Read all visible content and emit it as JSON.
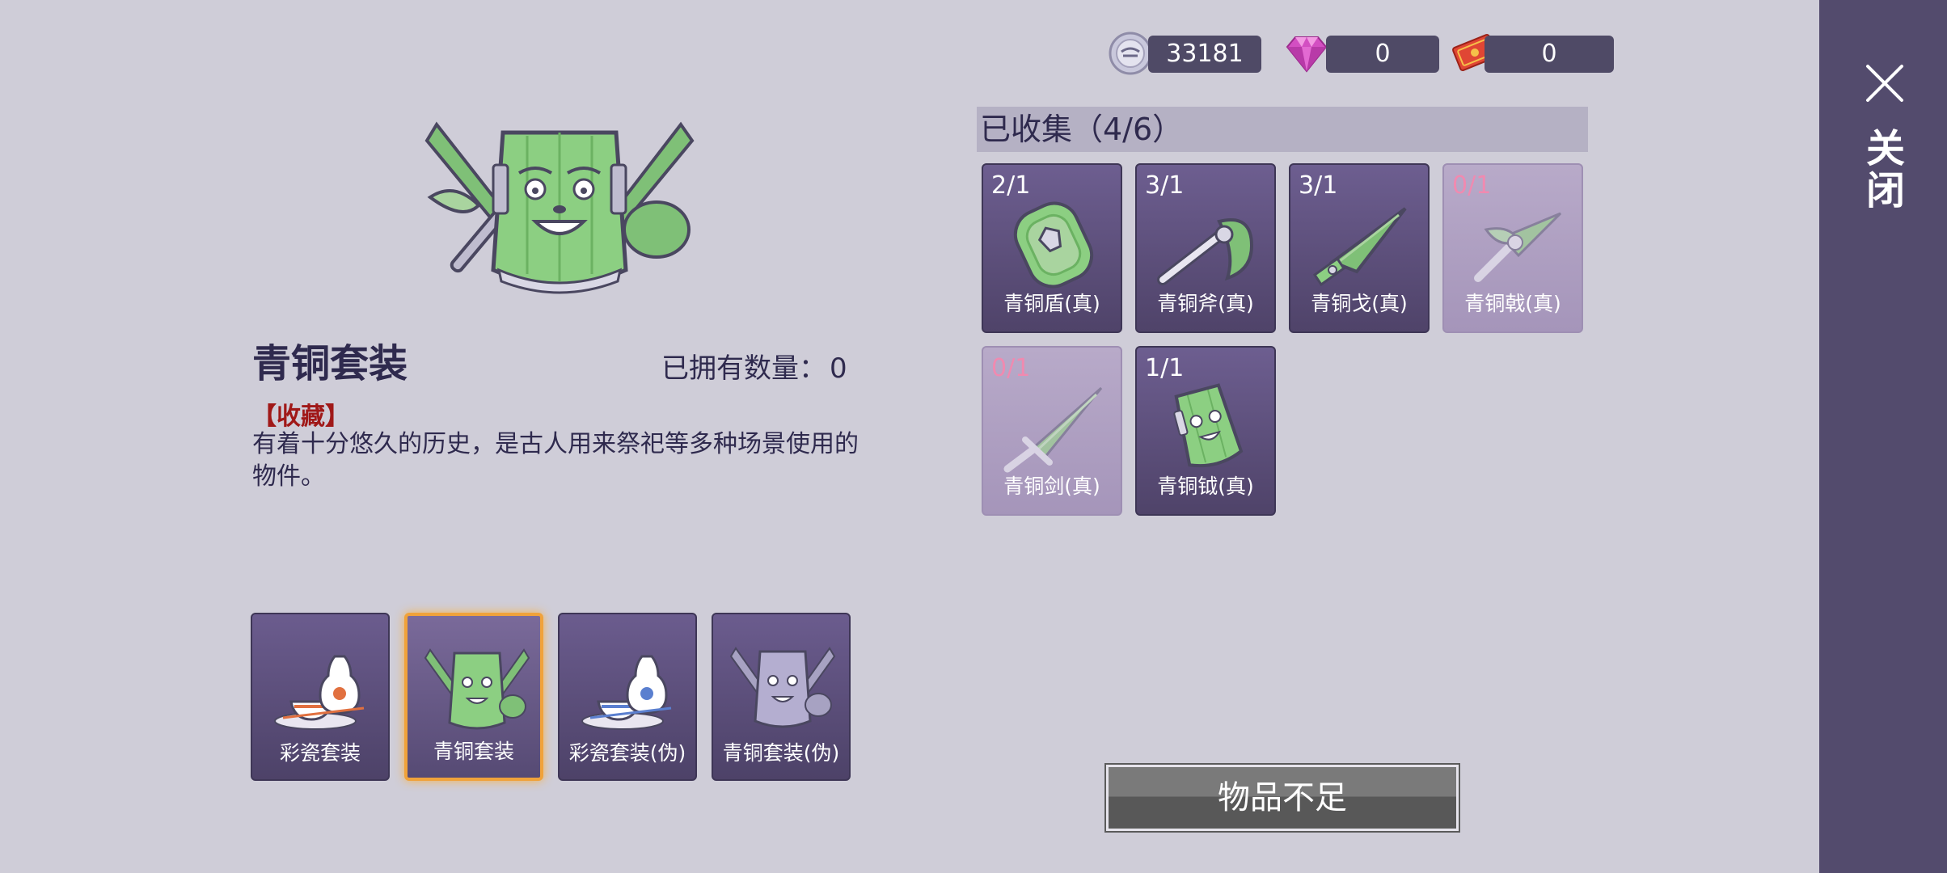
{
  "currency": {
    "coins": "33181",
    "gems": "0",
    "tickets": "0"
  },
  "close_label": "关闭",
  "detail": {
    "title": "青铜套装",
    "owned_label": "已拥有数量：",
    "owned_value": "0",
    "tag": "【收藏】",
    "description": "有着十分悠久的历史，是古人用来祭祀等多种场景使用的物件。"
  },
  "sets": [
    {
      "label": "彩瓷套装",
      "icon": "porcelain-set-icon",
      "selected": false
    },
    {
      "label": "青铜套装",
      "icon": "bronze-set-icon",
      "selected": true
    },
    {
      "label": "彩瓷套装(伪)",
      "icon": "porcelain-set-fake-icon",
      "selected": false
    },
    {
      "label": "青铜套装(伪)",
      "icon": "bronze-set-fake-icon",
      "selected": false
    }
  ],
  "collection": {
    "title": "已收集（4/6）",
    "items": [
      {
        "count": "2/1",
        "label": "青铜盾(真)",
        "icon": "bronze-shield-icon",
        "collected": true
      },
      {
        "count": "3/1",
        "label": "青铜斧(真)",
        "icon": "bronze-axe-icon",
        "collected": true
      },
      {
        "count": "3/1",
        "label": "青铜戈(真)",
        "icon": "bronze-dagger-axe-icon",
        "collected": true
      },
      {
        "count": "0/1",
        "label": "青铜戟(真)",
        "icon": "bronze-halberd-icon",
        "collected": false
      },
      {
        "count": "0/1",
        "label": "青铜剑(真)",
        "icon": "bronze-sword-icon",
        "collected": false
      },
      {
        "count": "1/1",
        "label": "青铜钺(真)",
        "icon": "bronze-yue-icon",
        "collected": true
      }
    ]
  },
  "action_button": "物品不足",
  "colors": {
    "background": "#cfcdd8",
    "panel": "#534b6d",
    "card": "#5e5180",
    "selected_border": "#f0a23a",
    "missing_count": "#f08ab0",
    "tag": "#a01818"
  }
}
